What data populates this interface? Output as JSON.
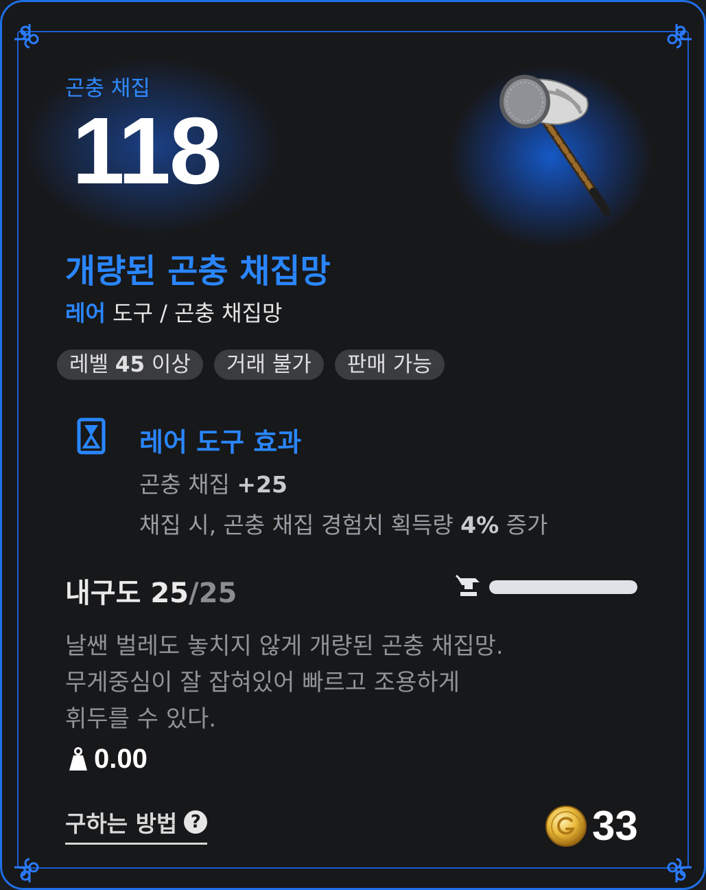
{
  "header": {
    "category": "곤충 채집",
    "level_value": "118"
  },
  "item": {
    "name": "개량된 곤충 채집망",
    "rarity": "레어",
    "type": " 도구 / 곤충 채집망",
    "icon": "bug-net-icon"
  },
  "tags": [
    {
      "pre": "레벨 ",
      "bold": "45",
      "post": " 이상"
    },
    {
      "pre": "거래 불가",
      "bold": "",
      "post": ""
    },
    {
      "pre": "판매 가능",
      "bold": "",
      "post": ""
    }
  ],
  "effect": {
    "icon": "hourglass-card-icon",
    "title": "레어 도구 효과",
    "line1_pre": "곤충 채집 ",
    "line1_bold": "+25",
    "line2_pre": "채집 시, 곤충 채집 경험치 획득량 ",
    "line2_bold": "4%",
    "line2_post": " 증가"
  },
  "durability": {
    "label": "내구도 ",
    "current": "25",
    "max": "/25",
    "fill_fraction": 1.0,
    "icon": "anvil-icon"
  },
  "description": [
    "날쌘 벌레도 놓치지 않게 개량된 곤충 채집망.",
    "무게중심이 잘 잡혀있어 빠르고 조용하게",
    "휘두를 수 있다."
  ],
  "weight": {
    "icon": "weight-icon",
    "value": "0.00"
  },
  "how_to_obtain": {
    "label": "구하는 방법",
    "icon": "help-icon",
    "icon_glyph": "?"
  },
  "price": {
    "icon": "gold-coin-icon",
    "value": "33"
  },
  "colors": {
    "accent": "#2a86ff",
    "border": "#1f6fe6",
    "background": "#17181a"
  }
}
